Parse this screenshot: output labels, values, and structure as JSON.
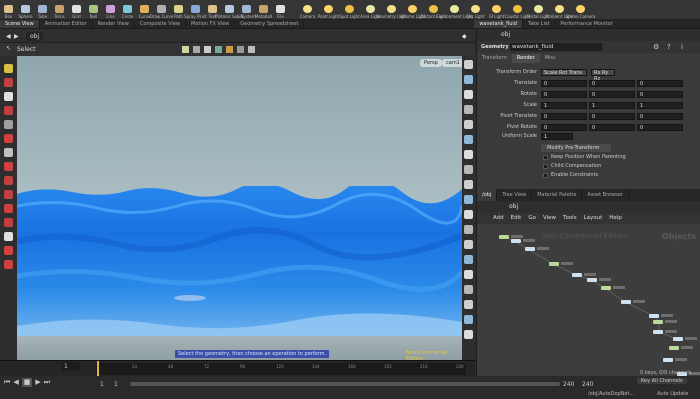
{
  "shelf": {
    "tools": [
      {
        "label": "Box",
        "icon": "box-icon"
      },
      {
        "label": "Sphere",
        "icon": "sphere-icon"
      },
      {
        "label": "Tube",
        "icon": "tube-icon"
      },
      {
        "label": "Torus",
        "icon": "torus-icon"
      },
      {
        "label": "Grid",
        "icon": "grid-icon"
      },
      {
        "label": "Null",
        "icon": "null-icon"
      },
      {
        "label": "Line",
        "icon": "line-icon"
      },
      {
        "label": "Circle",
        "icon": "circle-icon"
      },
      {
        "label": "Curve",
        "icon": "curve-icon"
      },
      {
        "label": "Draw Curve",
        "icon": "draw-curve-icon"
      },
      {
        "label": "Path",
        "icon": "path-icon"
      },
      {
        "label": "Spray Paint",
        "icon": "spray-paint-icon"
      },
      {
        "label": "Text",
        "icon": "text-icon"
      },
      {
        "label": "Platonic Solids",
        "icon": "platonic-icon"
      },
      {
        "label": "L-System",
        "icon": "lsystem-icon"
      },
      {
        "label": "Metaball",
        "icon": "metaball-icon"
      },
      {
        "label": "File",
        "icon": "file-icon"
      }
    ],
    "lights": [
      {
        "label": "Camera",
        "icon": "camera-icon"
      },
      {
        "label": "Point Light",
        "icon": "point-light-icon"
      },
      {
        "label": "Spot Light",
        "icon": "spot-light-icon"
      },
      {
        "label": "Area Light",
        "icon": "area-light-icon"
      },
      {
        "label": "Geometry Light",
        "icon": "geometry-light-icon"
      },
      {
        "label": "Volume Light",
        "icon": "volume-light-icon"
      },
      {
        "label": "Distant Light",
        "icon": "distant-light-icon"
      },
      {
        "label": "Environment Light",
        "icon": "environment-light-icon"
      },
      {
        "label": "Sky Light",
        "icon": "sky-light-icon"
      },
      {
        "label": "GI Light",
        "icon": "gi-light-icon"
      },
      {
        "label": "Caustic Light",
        "icon": "caustic-light-icon"
      },
      {
        "label": "Portal Light",
        "icon": "portal-light-icon"
      },
      {
        "label": "Ambient Light",
        "icon": "ambient-light-icon"
      },
      {
        "label": "Stereo Camera",
        "icon": "stereo-camera-icon"
      }
    ]
  },
  "tabs": [
    "Scene View",
    "Animation Editor",
    "Render View",
    "Composite View",
    "Motion FX View",
    "Geometry Spreadsheet"
  ],
  "right_tabs": [
    "wavetank_fluid",
    "Take List",
    "Performance Monitor"
  ],
  "viewer": {
    "path": "obj",
    "mode": "Select",
    "persp": "Persp",
    "cam": "cam1",
    "status_msg": "Select the geometry, then choose an operation to perform.",
    "watermark": "Non-Commercial Edition"
  },
  "params": {
    "type": "Geometry",
    "name": "wavetank_fluid",
    "tabs": [
      "Transform",
      "Render",
      "Misc"
    ],
    "transform_order": {
      "label": "Transform Order",
      "value": "Scale Rot Trans",
      "rot": "Rx Ry Rz"
    },
    "rows": [
      {
        "label": "Translate",
        "v": [
          "0",
          "0",
          "0"
        ]
      },
      {
        "label": "Rotate",
        "v": [
          "0",
          "0",
          "0"
        ]
      },
      {
        "label": "Scale",
        "v": [
          "1",
          "1",
          "1"
        ]
      },
      {
        "label": "Pivot Translate",
        "v": [
          "0",
          "0",
          "0"
        ]
      },
      {
        "label": "Pivot Rotate",
        "v": [
          "0",
          "0",
          "0"
        ]
      }
    ],
    "uniform": {
      "label": "Uniform Scale",
      "value": "1"
    },
    "modify": "Modify Pre-Transform",
    "checks": [
      "Keep Position When Parenting",
      "Child Compensation",
      "Enable Constraints"
    ]
  },
  "network": {
    "tabs": [
      "/obj",
      "Tree View",
      "Material Palette",
      "Asset Browser"
    ],
    "path": "obj",
    "menu": [
      "Add",
      "Edit",
      "Go",
      "View",
      "Tools",
      "Layout",
      "Help"
    ],
    "watermark": "Non-Commercial Edition",
    "context": "Objects"
  },
  "timeline": {
    "frame": "1",
    "start": "1",
    "end": "240",
    "end2": "240",
    "ticks": [
      "24",
      "48",
      "72",
      "96",
      "120",
      "144",
      "168",
      "192",
      "216",
      "240"
    ],
    "start_frame": "1"
  },
  "footer": {
    "keys": "0 keys, 0/0 channels",
    "key_all": "Key All Channels",
    "path": "/obj/AutoDopNet...",
    "update": "Auto Update"
  }
}
